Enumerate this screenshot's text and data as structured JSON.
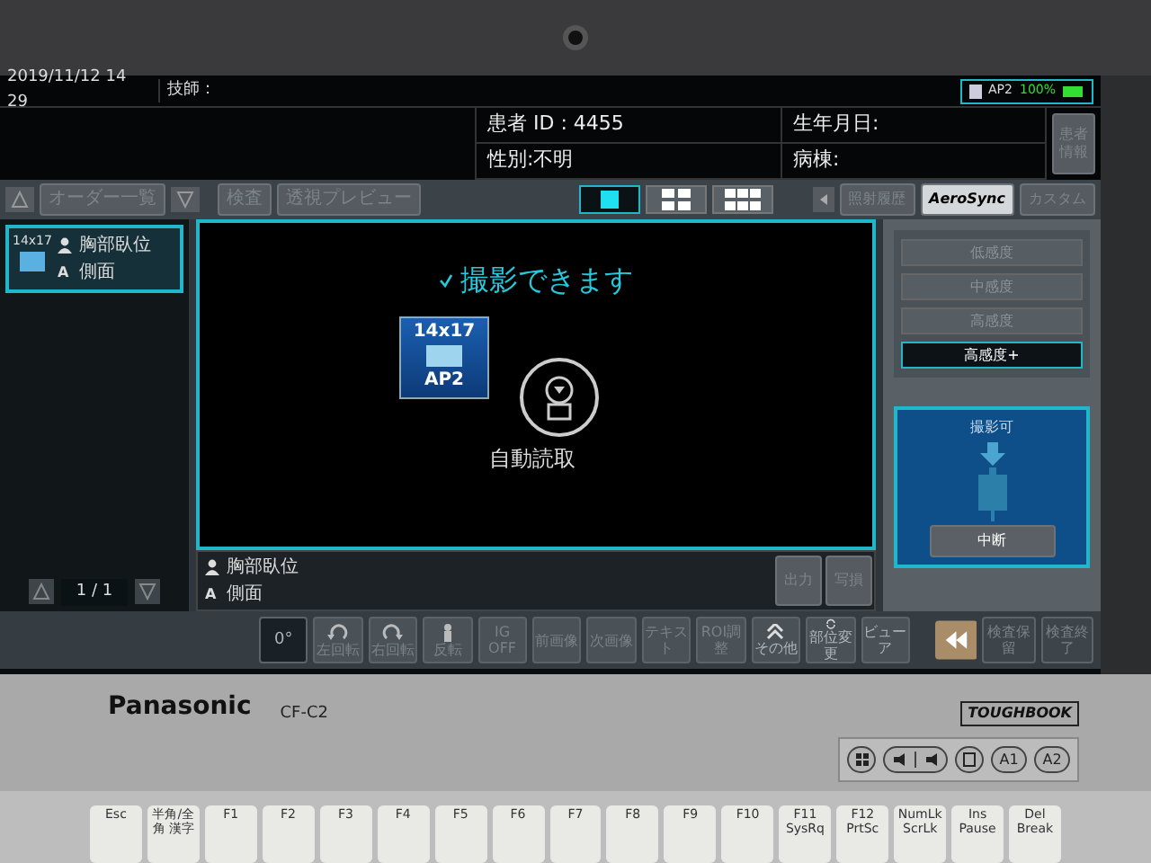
{
  "status_bar": {
    "datetime": "2019/11/12 14 29",
    "technician": "技師：",
    "device": "AP2",
    "battery": "100%"
  },
  "patient": {
    "id": "患者 ID : 4455",
    "birth": "生年月日:",
    "sex": "性別:不明",
    "ward": "病棟:",
    "info_button": "患者情報"
  },
  "order_panel": {
    "button": "オーダー一覧",
    "page": "1 / 1",
    "items": [
      {
        "size": "14x17",
        "selected": true,
        "lines": [
          {
            "kind": "body",
            "text": "胸部臥位"
          },
          {
            "kind": "view",
            "mark": "A",
            "text": "側面"
          }
        ]
      }
    ]
  },
  "view_tabs": [
    {
      "label": "検査",
      "disabled": true
    },
    {
      "label": "透視プレビュー",
      "disabled": true
    }
  ],
  "layout_buttons": [
    {
      "kind": "single",
      "selected": true
    },
    {
      "kind": "quad",
      "selected": false
    },
    {
      "kind": "six",
      "selected": false
    }
  ],
  "side_tabs": [
    {
      "label": "照射履歴",
      "selected": false
    },
    {
      "label": "AeroSync",
      "selected": true
    },
    {
      "label": "カスタム",
      "selected": false
    }
  ],
  "viewer": {
    "message": "撮影できます",
    "cassette": {
      "size": "14x17",
      "name": "AP2"
    },
    "mode": "自動読取",
    "info_lines": [
      {
        "kind": "body",
        "text": "胸部臥位"
      },
      {
        "kind": "view",
        "mark": "A",
        "text": "側面"
      }
    ],
    "buttons": [
      "出力",
      "写損"
    ]
  },
  "sensitivity": [
    {
      "label": "低感度",
      "selected": false
    },
    {
      "label": "中感度",
      "selected": false
    },
    {
      "label": "高感度",
      "selected": false
    },
    {
      "label": "高感度+",
      "selected": true
    }
  ],
  "exposure": {
    "status": "撮影可",
    "button": "中断"
  },
  "toolbar": [
    {
      "kind": "text",
      "label": "0°",
      "disabled": false
    },
    {
      "kind": "rotate-left",
      "label": "左回転",
      "disabled": true
    },
    {
      "kind": "rotate-right",
      "label": "右回転",
      "disabled": true
    },
    {
      "kind": "flip",
      "label": "反転",
      "disabled": true
    },
    {
      "kind": "text",
      "label": "IG OFF",
      "disabled": true
    },
    {
      "kind": "text",
      "label": "前画像",
      "disabled": true
    },
    {
      "kind": "text",
      "label": "次画像",
      "disabled": true
    },
    {
      "kind": "text",
      "label": "テキスト",
      "disabled": true
    },
    {
      "kind": "text",
      "label": "ROI調整",
      "disabled": true
    },
    {
      "kind": "chevrons",
      "label": "その他",
      "disabled": false
    },
    {
      "kind": "refresh",
      "label": "部位変更",
      "disabled": false
    },
    {
      "kind": "text",
      "label": "ビューア",
      "disabled": false
    }
  ],
  "exam_buttons": [
    {
      "label": "検査保留",
      "disabled": true
    },
    {
      "label": "検査終了",
      "disabled": true
    }
  ],
  "laptop": {
    "brand": "Panasonic",
    "model": "CF-C2",
    "series": "TOUGHBOOK",
    "hard_buttons": [
      {
        "kind": "windows"
      },
      {
        "kind": "volume"
      },
      {
        "kind": "rotate"
      },
      {
        "kind": "label",
        "label": "A1"
      },
      {
        "kind": "label",
        "label": "A2"
      }
    ],
    "keys": [
      "Esc",
      "半角/全角 漢字",
      "F1",
      "F2",
      "F3",
      "F4",
      "F5",
      "F6",
      "F7",
      "F8",
      "F9",
      "F10",
      "F11 SysRq",
      "F12 PrtSc",
      "NumLk ScrLk",
      "Ins Pause",
      "Del Break"
    ]
  }
}
